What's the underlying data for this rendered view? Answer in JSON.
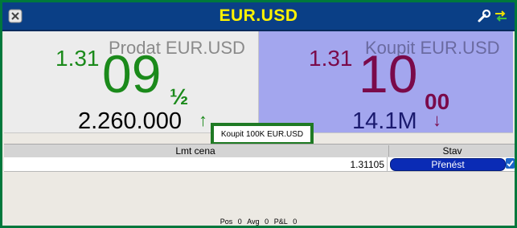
{
  "window": {
    "title": "EUR.USD"
  },
  "sell": {
    "label": "Prodat EUR.USD",
    "price_prefix": "1.31",
    "price_main": "09",
    "price_fraction": "½",
    "size": "2.260.000",
    "trend_arrow": "↑"
  },
  "buy": {
    "label": "Koupit EUR.USD",
    "price_prefix": "1.31",
    "price_main": "10",
    "price_fraction": "00",
    "size": "14.1M",
    "trend_arrow": "↓"
  },
  "order_preview": {
    "text": "Koupit 100K EUR.USD"
  },
  "orders_table": {
    "headers": [
      "Lmt cena",
      "Stav"
    ],
    "rows": [
      {
        "limit_price": "1.31105",
        "action_label": "Přenést"
      }
    ]
  },
  "footer": {
    "pos_label": "Pos",
    "pos_value": "0",
    "avg_label": "Avg",
    "avg_value": "0",
    "pnl_label": "P&L",
    "pnl_value": "0"
  },
  "colors": {
    "frame": "#00783c",
    "titlebar": "#0a3f86",
    "title_text": "#fff200",
    "sell_price": "#1b8a1b",
    "buy_price": "#7a0a4a",
    "buy_panel": "#a3a6ee",
    "transfer_button": "#0a2bb5"
  },
  "icons": {
    "title_left": "close-icon",
    "title_right_1": "wrench-icon",
    "title_right_2": "swap-arrows-icon",
    "row_status": "checkmark-icon"
  }
}
